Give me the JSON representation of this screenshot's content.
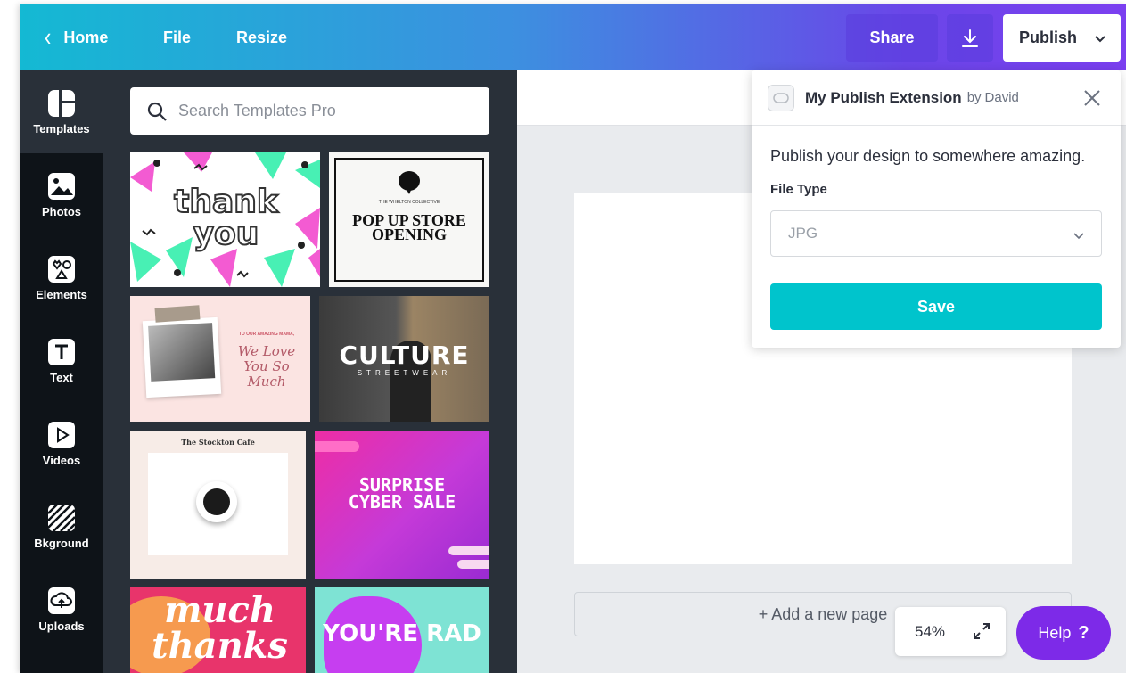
{
  "topbar": {
    "home_label": "Home",
    "file_label": "File",
    "resize_label": "Resize",
    "share_label": "Share",
    "download_icon": "download-icon",
    "publish_label": "Publish"
  },
  "rail": {
    "items": [
      {
        "label": "Templates",
        "icon": "templates-icon",
        "active": true
      },
      {
        "label": "Photos",
        "icon": "photos-icon"
      },
      {
        "label": "Elements",
        "icon": "elements-icon"
      },
      {
        "label": "Text",
        "icon": "text-icon"
      },
      {
        "label": "Videos",
        "icon": "videos-icon"
      },
      {
        "label": "Bkground",
        "icon": "background-icon"
      },
      {
        "label": "Uploads",
        "icon": "uploads-icon"
      }
    ]
  },
  "templates": {
    "search_placeholder": "Search Templates Pro",
    "items": [
      {
        "text": "thank you"
      },
      {
        "brand": "THE WHELTON COLLECTIVE",
        "text": "POP UP STORE OPENING"
      },
      {
        "kicker": "TO OUR AMAZING MAMA,",
        "text": "We Love You So Much"
      },
      {
        "text": "CULTURE",
        "subtext": "STREETWEAR"
      },
      {
        "text": "The Stockton Cafe"
      },
      {
        "text": "SURPRISE CYBER SALE"
      },
      {
        "text": "much thanks"
      },
      {
        "text": "YOU'RE RAD"
      }
    ]
  },
  "canvas": {
    "add_page_label": "+ Add a new page",
    "zoom_level": "54%",
    "help_label": "Help",
    "help_mark": "?"
  },
  "publish_popover": {
    "title": "My Publish Extension",
    "by_label": "by",
    "author": "David",
    "description": "Publish your design to somewhere amazing.",
    "file_type_label": "File Type",
    "file_type_value": "JPG",
    "save_label": "Save"
  },
  "colors": {
    "accent_teal": "#00c4cc",
    "help_purple": "#7d2ae8",
    "panel_dark": "#293039",
    "rail_dark": "#0e1318"
  }
}
